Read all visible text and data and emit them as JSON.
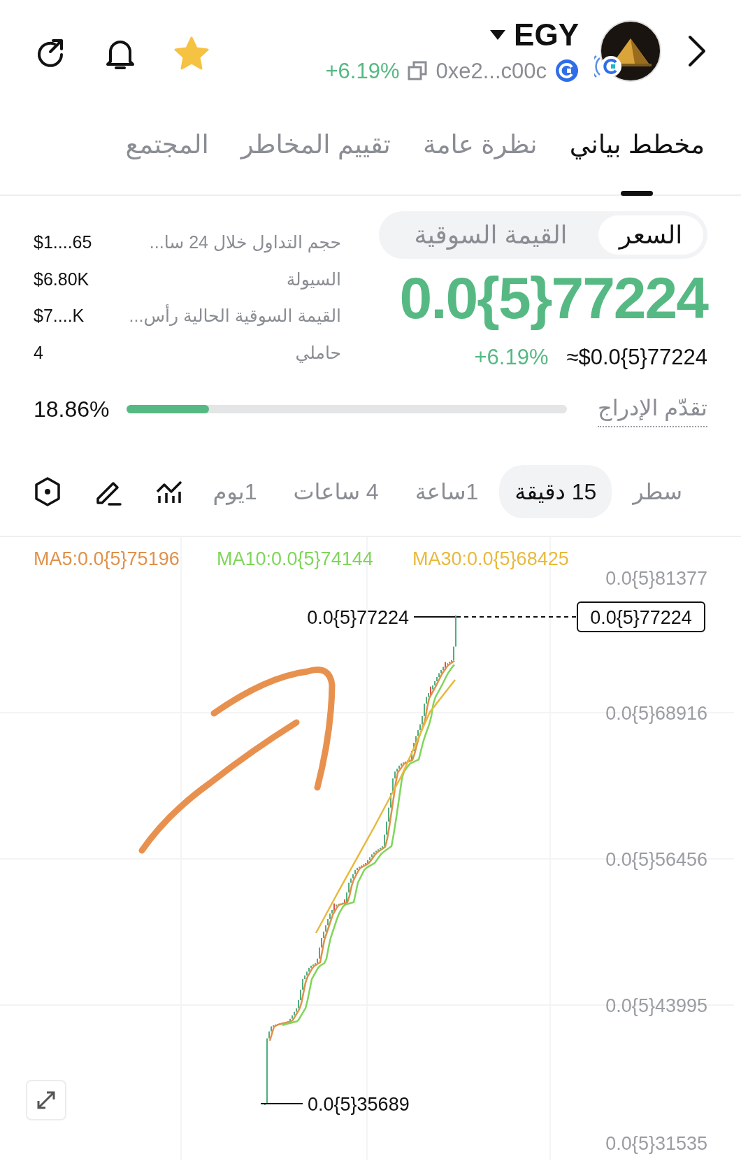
{
  "header": {
    "favorite": true,
    "token": "EGY",
    "change": "+6.19%",
    "address": "0xe2...c00c"
  },
  "tabs": [
    {
      "label": "مخطط بياني",
      "selected": true
    },
    {
      "label": "نظرة عامة",
      "selected": false
    },
    {
      "label": "تقييم المخاطر",
      "selected": false
    },
    {
      "label": "المجتمع",
      "selected": false
    }
  ],
  "price_toggle": [
    {
      "label": "السعر",
      "selected": true
    },
    {
      "label": "القيمة السوقية",
      "selected": false
    }
  ],
  "price": "0.0{5}77224",
  "price_change": "+6.19%",
  "price_usd": "≈$0.0{5}77224",
  "stats": [
    {
      "label": "حجم التداول خلال 24 سا...",
      "value": "$1....65"
    },
    {
      "label": "السيولة",
      "value": "$6.80K"
    },
    {
      "label": "القيمة السوقية الحالية رأس...",
      "value": "$7....K"
    },
    {
      "label": "حاملي",
      "value": "4"
    }
  ],
  "listing_progress": {
    "label": "تقدّم الإدراج",
    "level": 0.1886,
    "reading": "18.86%"
  },
  "intervals": [
    {
      "label": "سطر",
      "selected": false
    },
    {
      "label": "15 دقيقة",
      "selected": true
    },
    {
      "label": "1ساعة",
      "selected": false
    },
    {
      "label": "4 ساعات",
      "selected": false
    },
    {
      "label": "1يوم",
      "selected": false
    }
  ],
  "chart": {
    "ma5": {
      "label": "MA5:0.0{5}75196",
      "color": "#e0914a"
    },
    "ma10": {
      "label": "MA10:0.0{5}74144",
      "color": "#7fd65a"
    },
    "ma30": {
      "label": "MA30:0.0{5}68425",
      "color": "#e8b93c"
    },
    "y_labels": [
      "0.0{5}81377",
      "0.0{5}68916",
      "0.0{5}56456",
      "0.0{5}43995",
      "0.0{5}31535"
    ],
    "high_label": "0.0{5}77224",
    "current_price": "0.0{5}77224",
    "low_label": "0.0{5}35689"
  }
}
